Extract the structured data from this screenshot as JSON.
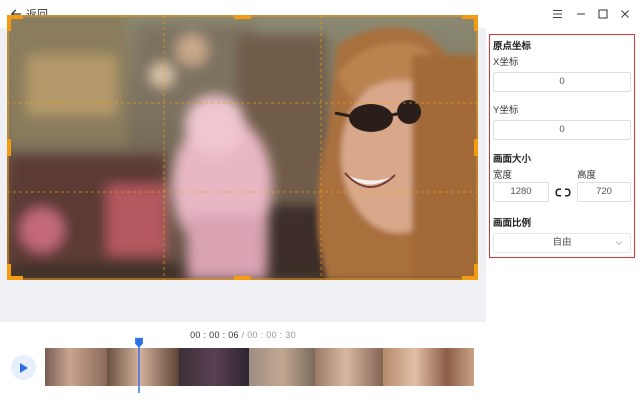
{
  "titlebar": {
    "back_label": "返回",
    "icons": [
      "back-arrow-icon",
      "menu-icon",
      "minimize-icon",
      "maximize-icon",
      "close-icon"
    ]
  },
  "panel": {
    "origin": {
      "title": "原点坐标",
      "x_label": "X坐标",
      "x_value": "0",
      "y_label": "Y坐标",
      "y_value": "0"
    },
    "size": {
      "title": "画面大小",
      "width_label": "宽度",
      "width_value": "1280",
      "height_label": "高度",
      "height_value": "720",
      "link_icon": "link-icon"
    },
    "ratio": {
      "title": "画面比例",
      "selected": "自由"
    }
  },
  "timeline": {
    "current": [
      "00",
      "00",
      "06"
    ],
    "total": "00 : 00 : 30"
  },
  "colors": {
    "accent_orange": "#f39c12",
    "panel_border": "#d9363e",
    "playhead_blue": "#2f6fe4",
    "play_button_bg": "#e7eefc"
  }
}
